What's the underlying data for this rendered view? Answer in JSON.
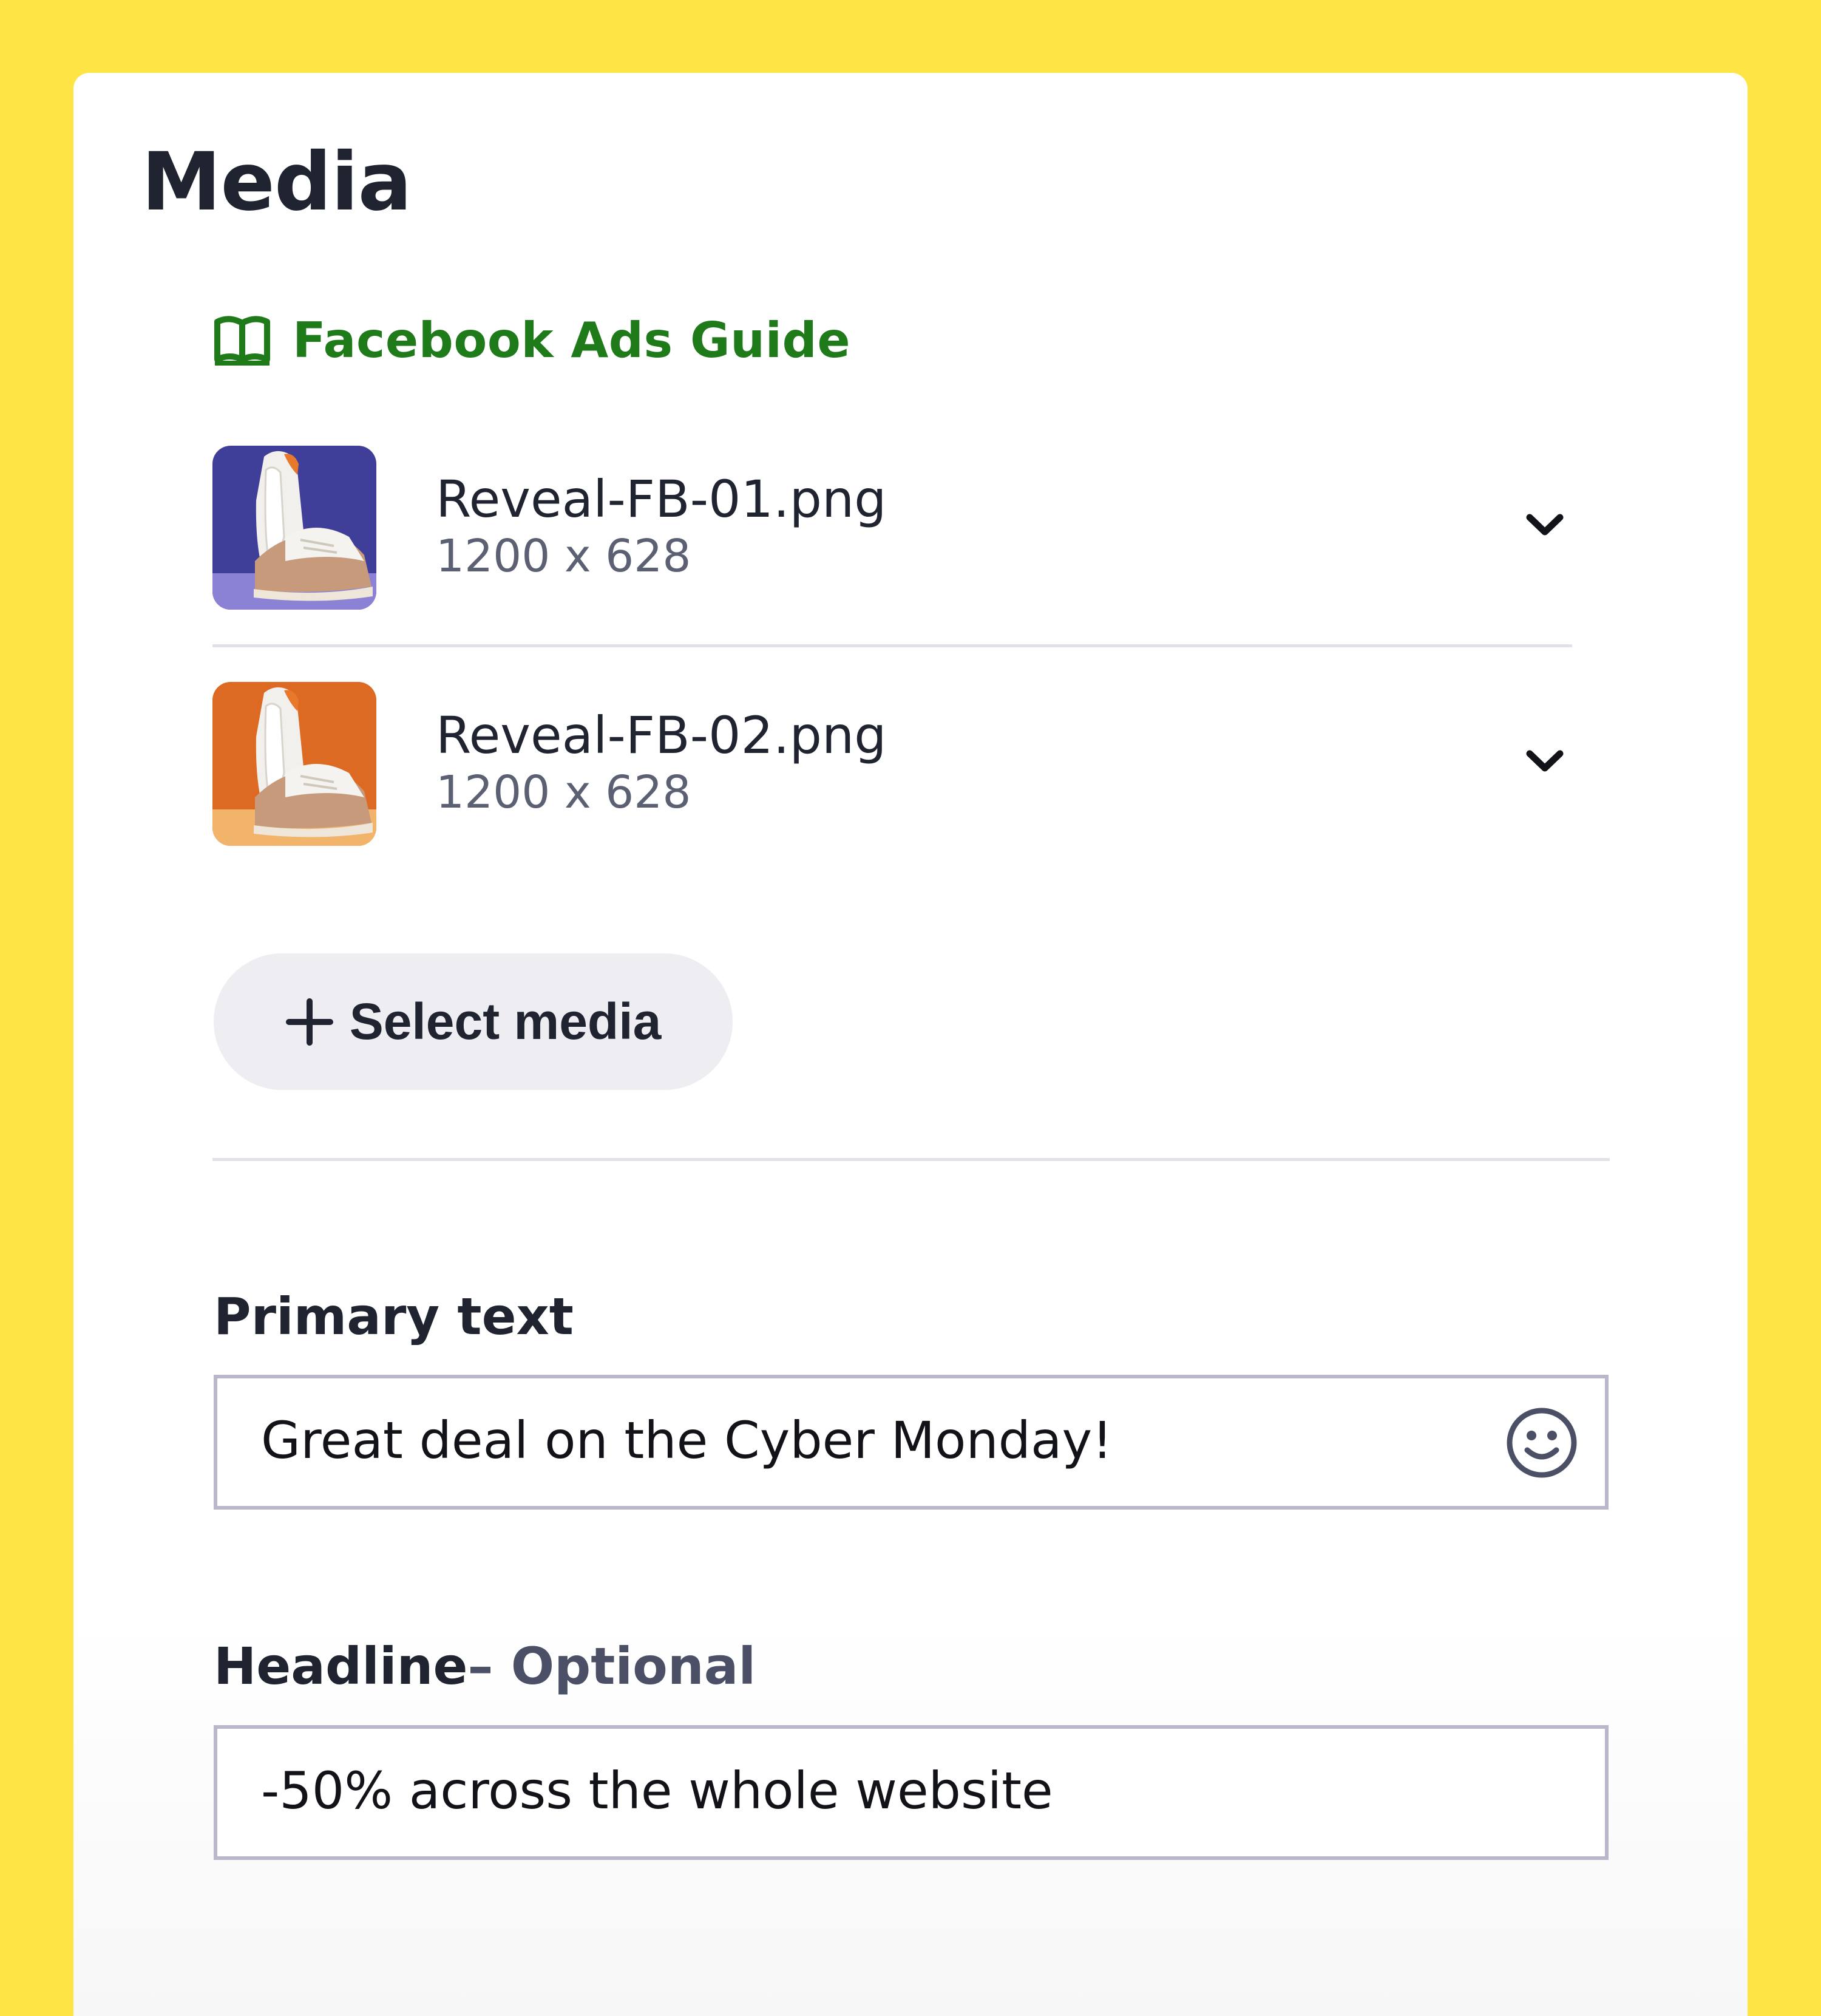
{
  "section": {
    "title": "Media",
    "guide_link": {
      "label": "Facebook Ads Guide",
      "icon": "book-open-icon",
      "color": "#1f7a1a"
    }
  },
  "media": [
    {
      "filename": "Reveal-FB-01.png",
      "dimensions": "1200 x 628",
      "thumbnail": "sneakers-purple-background",
      "expand_icon": "chevron-down-icon"
    },
    {
      "filename": "Reveal-FB-02.png",
      "dimensions": "1200 x 628",
      "thumbnail": "sneakers-orange-background",
      "expand_icon": "chevron-down-icon"
    }
  ],
  "select_media": {
    "label": "Select media",
    "icon": "plus-icon"
  },
  "primary_text": {
    "label": "Primary text",
    "value": "Great deal on the Cyber Monday!",
    "emoji_icon": "smiley-icon"
  },
  "headline": {
    "label": "Headline",
    "optional_label": "– Optional",
    "value": "-50% across the whole website"
  },
  "colors": {
    "page_background": "#FFE446",
    "text_primary": "#1f2430",
    "link_green": "#1f7a1a",
    "button_bg": "#eeeef2",
    "input_border": "#b8b7cc"
  }
}
